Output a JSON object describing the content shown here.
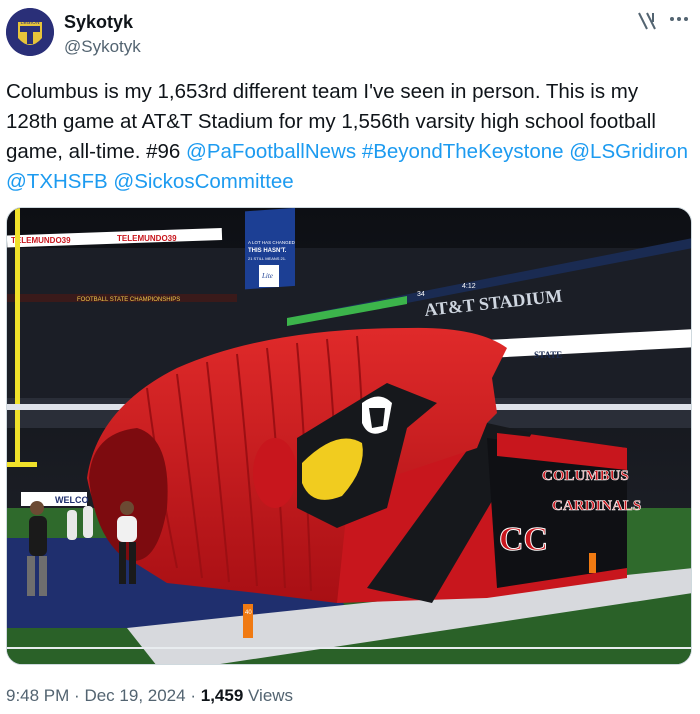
{
  "author": {
    "name": "Sykotyk",
    "handle": "@Sykotyk"
  },
  "post": {
    "text_parts": [
      {
        "type": "text",
        "value": "Columbus is my 1,653rd different team I've seen in person. This is my 128th game at AT&T Stadium for my 1,556th varsity high school football game, all-time. #96 "
      },
      {
        "type": "link",
        "value": "@PaFootballNews"
      },
      {
        "type": "text",
        "value": " "
      },
      {
        "type": "link",
        "value": "#BeyondTheKeystone"
      },
      {
        "type": "text",
        "value": " "
      },
      {
        "type": "link",
        "value": "@LSGridiron"
      },
      {
        "type": "text",
        "value": " "
      },
      {
        "type": "link",
        "value": "@TXHSFB"
      },
      {
        "type": "text",
        "value": " "
      },
      {
        "type": "link",
        "value": "@SickosCommittee"
      }
    ],
    "time": "9:48 PM",
    "separator": "·",
    "date": "Dec 19, 2024",
    "views_count": "1,459",
    "views_label": "Views"
  },
  "image": {
    "stadium_sign": "AT&T STADIUM",
    "banner_left": "TELEMUNDO39",
    "ribbon_text": "FOOTBALL STATE CHAMPIONSHIPS",
    "ad_line1": "A LOT HAS CHANGED",
    "ad_line2": "THIS HASN'T.",
    "ad_line3": "21 STILL MEANS 21.",
    "ad_brand": "Lite",
    "score_text": "34",
    "clock_text": "4:12",
    "mascot_line1": "COLUMBUS",
    "mascot_line2": "CARDINALS",
    "mascot_logo": "CC",
    "state_logo": "STATE",
    "welcome_text": "WELCO",
    "yard_marker": "40"
  },
  "colors": {
    "link": "#1d9bf0",
    "secondary_text": "#536471",
    "primary_text": "#0f1419",
    "cardinal_red": "#c8161d",
    "beak_yellow": "#f1cc1f"
  },
  "icons": {
    "grok": "grok-icon",
    "more": "more-icon",
    "avatar": "avatar"
  }
}
